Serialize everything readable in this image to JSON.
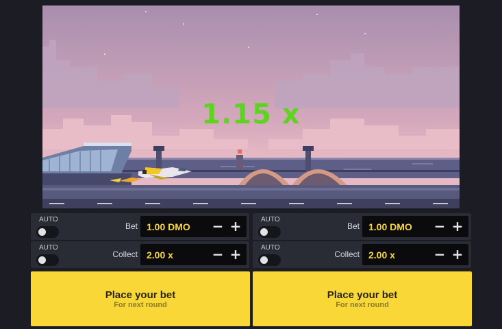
{
  "game": {
    "multiplier": "1.15 x",
    "colors": {
      "multiplier": "#5dd420",
      "sky": "#b59cb6",
      "accent": "#f8d737"
    },
    "scene": [
      "airport-terminal-icon",
      "control-tower-icon",
      "jet-plane-icon",
      "hangar-icon"
    ]
  },
  "panels": [
    {
      "bet": {
        "auto_label": "AUTO",
        "label": "Bet",
        "value": "1.00 DMO",
        "minus": "−",
        "plus": "+"
      },
      "collect": {
        "auto_label": "AUTO",
        "label": "Collect",
        "value": "2.00 x",
        "minus": "−",
        "plus": "+"
      },
      "button": {
        "label": "Place your bet",
        "sub": "For next round"
      }
    },
    {
      "bet": {
        "auto_label": "AUTO",
        "label": "Bet",
        "value": "1.00 DMO",
        "minus": "−",
        "plus": "+"
      },
      "collect": {
        "auto_label": "AUTO",
        "label": "Collect",
        "value": "2.00 x",
        "minus": "−",
        "plus": "+"
      },
      "button": {
        "label": "Place your bet",
        "sub": "For next round"
      }
    }
  ]
}
